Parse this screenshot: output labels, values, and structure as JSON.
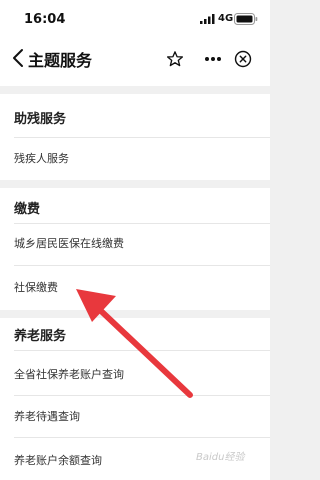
{
  "status_bar": {
    "time": "16:04",
    "network": "4G"
  },
  "nav": {
    "title": "主题服务",
    "icons": [
      "back-chevron-icon",
      "star-icon",
      "more-icon",
      "close-circle-icon"
    ]
  },
  "sections": [
    {
      "header": "助残服务",
      "items": [
        "残疾人服务"
      ]
    },
    {
      "header": "缴费",
      "items": [
        "城乡居民医保在线缴费",
        "社保缴费"
      ]
    },
    {
      "header": "养老服务",
      "items": [
        "全省社保养老账户查询",
        "养老待遇查询",
        "养老账户余额查询"
      ]
    }
  ],
  "annotation": {
    "arrow_color": "#e8383d",
    "points_to": "社保缴费"
  },
  "watermark": "Baidu经验"
}
